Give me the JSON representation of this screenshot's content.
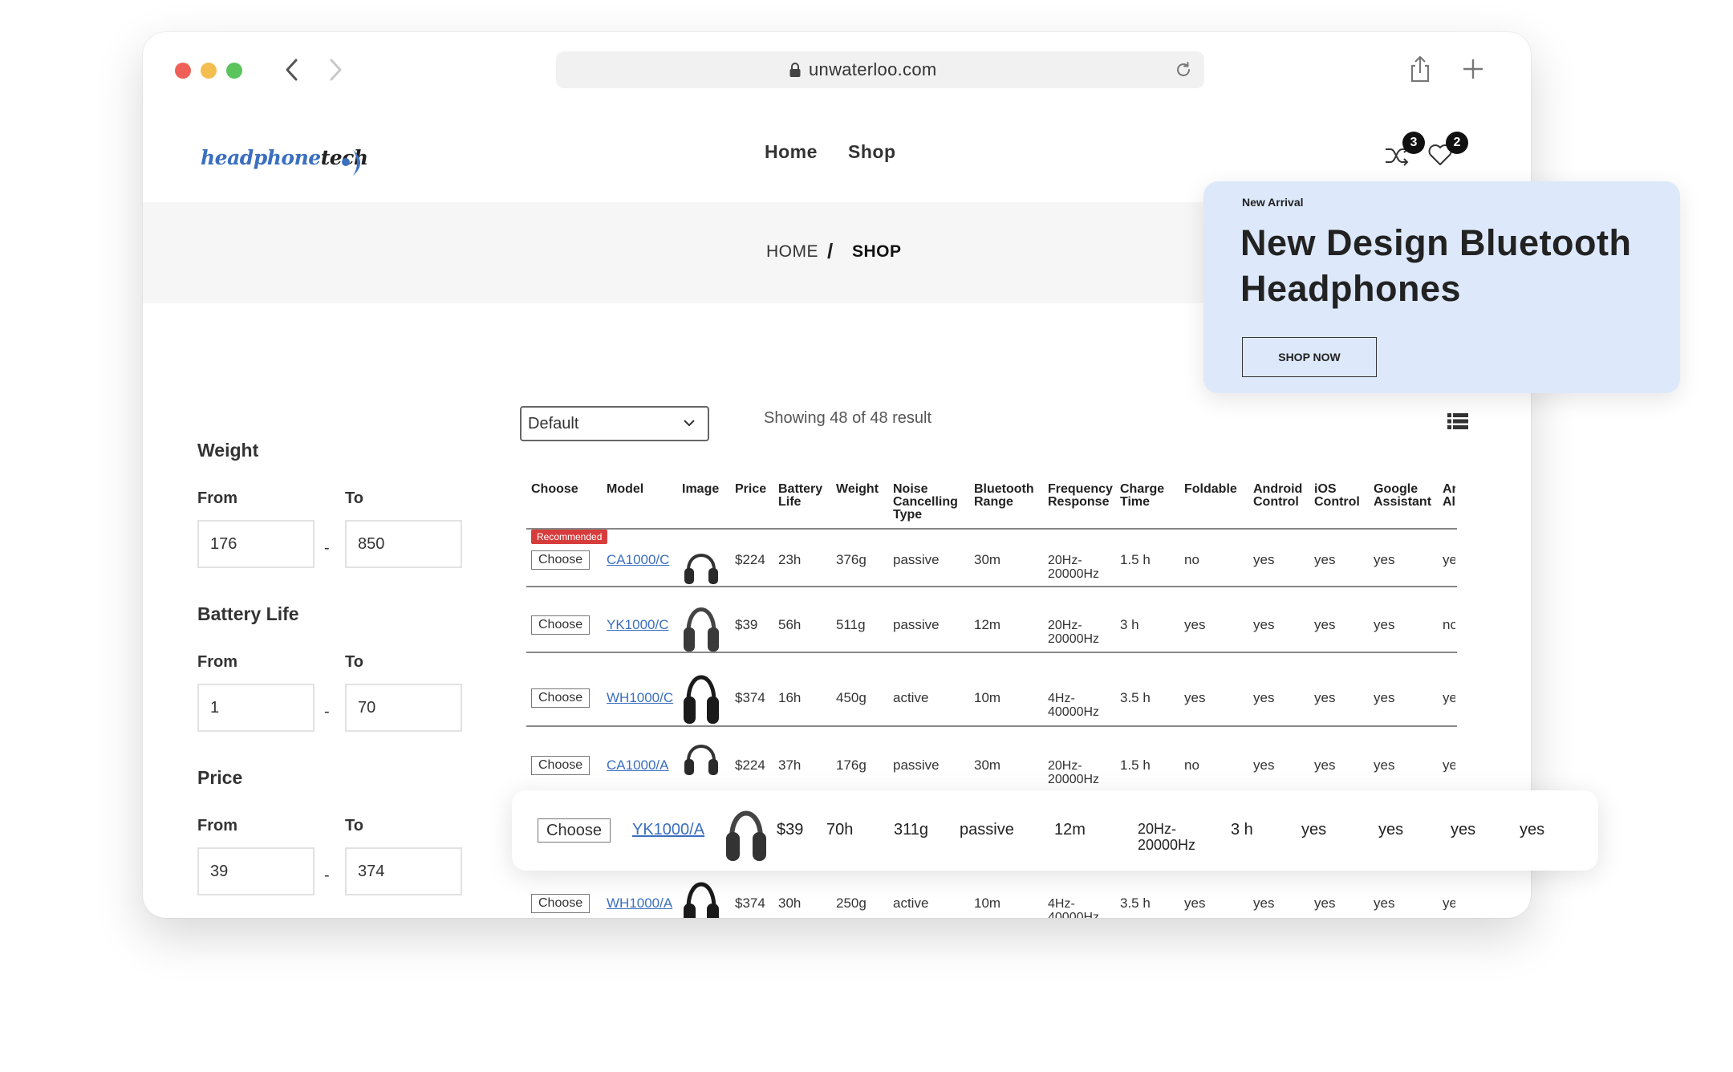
{
  "browser": {
    "url": "unwaterloo.com"
  },
  "site": {
    "logo_part1": "headphone",
    "logo_part2": "tech",
    "nav": [
      "Home",
      "Shop"
    ],
    "compare_count": "3",
    "wishlist_count": "2"
  },
  "breadcrumb": {
    "home": "HOME",
    "sep": "/",
    "current": "SHOP"
  },
  "promo": {
    "eyebrow": "New Arrival",
    "title": "New Design Bluetooth Headphones",
    "button": "SHOP NOW"
  },
  "filters": {
    "from_label": "From",
    "to_label": "To",
    "dash": "-",
    "weight": {
      "title": "Weight",
      "from": "176",
      "to": "850"
    },
    "battery": {
      "title": "Battery Life",
      "from": "1",
      "to": "70"
    },
    "price": {
      "title": "Price",
      "from": "39",
      "to": "374"
    }
  },
  "toolbar": {
    "sort": "Default",
    "showing": "Showing 48 of 48 result"
  },
  "table": {
    "headers": {
      "choose": "Choose",
      "model": "Model",
      "image": "Image",
      "price": "Price",
      "battery_l1": "Battery",
      "battery_l2": "Life",
      "weight": "Weight",
      "noise_l1": "Noise",
      "noise_l2": "Cancelling",
      "noise_l3": "Type",
      "bt_l1": "Bluetooth",
      "bt_l2": "Range",
      "freq_l1": "Frequency",
      "freq_l2": "Response",
      "charge_l1": "Charge",
      "charge_l2": "Time",
      "foldable": "Foldable",
      "android_l1": "Android",
      "android_l2": "Control",
      "ios_l1": "iOS",
      "ios_l2": "Control",
      "google_l1": "Google",
      "google_l2": "Assistant",
      "cut_l1": "Ar",
      "cut_l2": "Al"
    },
    "recommended_badge": "Recommended",
    "choose_label": "Choose",
    "rows": [
      {
        "model": "CA1000/C",
        "price": "$224",
        "battery": "23h",
        "weight": "376g",
        "noise": "passive",
        "bt": "30m",
        "freq_l1": "20Hz-",
        "freq_l2": "20000Hz",
        "charge": "1.5 h",
        "foldable": "no",
        "android": "yes",
        "ios": "yes",
        "google": "yes",
        "cut": "ye"
      },
      {
        "model": "YK1000/C",
        "price": "$39",
        "battery": "56h",
        "weight": "511g",
        "noise": "passive",
        "bt": "12m",
        "freq_l1": "20Hz-",
        "freq_l2": "20000Hz",
        "charge": "3 h",
        "foldable": "yes",
        "android": "yes",
        "ios": "yes",
        "google": "yes",
        "cut": "no"
      },
      {
        "model": "WH1000/C",
        "price": "$374",
        "battery": "16h",
        "weight": "450g",
        "noise": "active",
        "bt": "10m",
        "freq_l1": "4Hz-",
        "freq_l2": "40000Hz",
        "charge": "3.5 h",
        "foldable": "yes",
        "android": "yes",
        "ios": "yes",
        "google": "yes",
        "cut": "ye"
      },
      {
        "model": "CA1000/A",
        "price": "$224",
        "battery": "37h",
        "weight": "176g",
        "noise": "passive",
        "bt": "30m",
        "freq_l1": "20Hz-",
        "freq_l2": "20000Hz",
        "charge": "1.5 h",
        "foldable": "no",
        "android": "yes",
        "ios": "yes",
        "google": "yes",
        "cut": "ye"
      },
      {
        "model": "WH1000/A",
        "price": "$374",
        "battery": "30h",
        "weight": "250g",
        "noise": "active",
        "bt": "10m",
        "freq_l1": "4Hz-",
        "freq_l2": "40000Hz",
        "charge": "3.5 h",
        "foldable": "yes",
        "android": "yes",
        "ios": "yes",
        "google": "yes",
        "cut": "ye"
      }
    ],
    "highlight": {
      "model": "YK1000/A",
      "price": "$39",
      "battery": "70h",
      "weight": "311g",
      "noise": "passive",
      "bt": "12m",
      "freq_l1": "20Hz-",
      "freq_l2": "20000Hz",
      "charge": "3 h",
      "foldable": "yes",
      "android": "yes",
      "ios": "yes",
      "google": "yes"
    }
  }
}
